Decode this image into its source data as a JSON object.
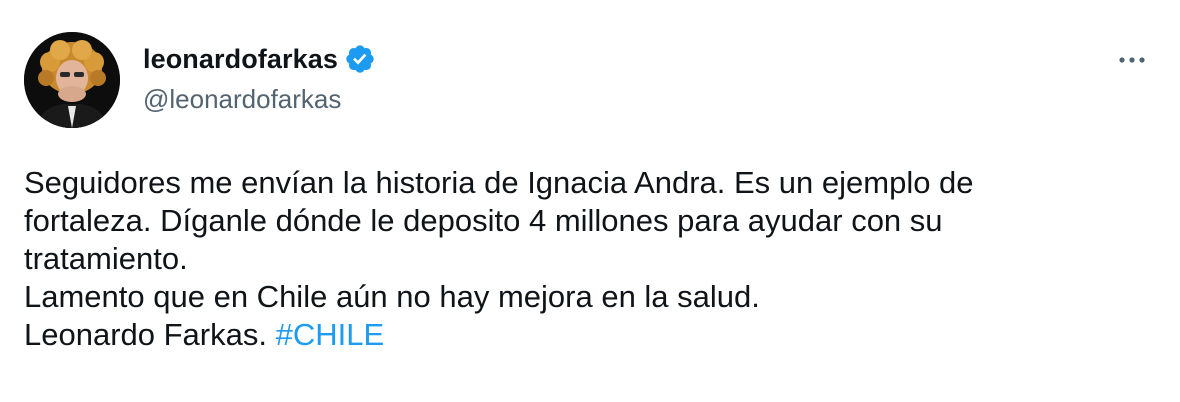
{
  "user": {
    "display_name": "leonardofarkas",
    "handle": "@leonardofarkas",
    "verified": true
  },
  "icons": {
    "avatar": "profile-photo",
    "verified": "verified-badge-icon",
    "more": "more-options-icon"
  },
  "tweet": {
    "lines": [
      "Seguidores me envían la historia de Ignacia Andra. Es un ejemplo de",
      "fortaleza. Díganle dónde le deposito 4 millones para ayudar con su",
      "tratamiento.",
      "Lamento que en Chile aún no hay mejora en la salud."
    ],
    "last_line_text": "Leonardo Farkas. ",
    "hashtag": "#CHILE"
  },
  "colors": {
    "text": "#0f1419",
    "secondary": "#536471",
    "accent": "#1d9bf0"
  }
}
